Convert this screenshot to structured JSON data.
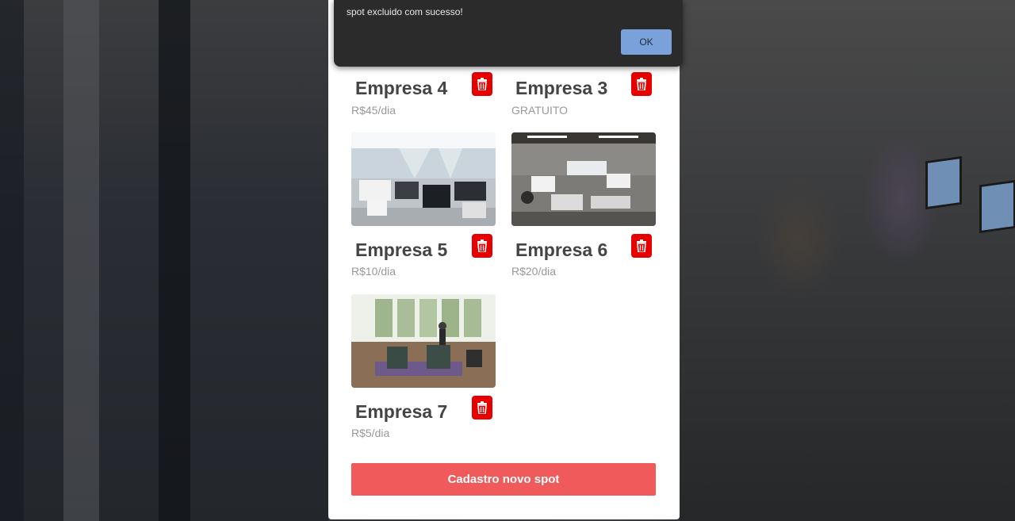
{
  "dialog": {
    "message": "spot excluido com sucesso!",
    "ok_label": "OK"
  },
  "spots": [
    {
      "name": "Empresa 4",
      "price": "R$45/dia"
    },
    {
      "name": "Empresa 3",
      "price": "GRATUITO"
    },
    {
      "name": "Empresa 5",
      "price": "R$10/dia"
    },
    {
      "name": "Empresa 6",
      "price": "R$20/dia"
    },
    {
      "name": "Empresa 7",
      "price": "R$5/dia"
    }
  ],
  "submit_label": "Cadastro novo spot",
  "colors": {
    "accent_red": "#f05a5a",
    "trash_red": "#e60000",
    "dialog_bg": "#2b2b2b",
    "ok_button": "#7aa1d9"
  },
  "icons": {
    "delete": "trash-icon"
  }
}
